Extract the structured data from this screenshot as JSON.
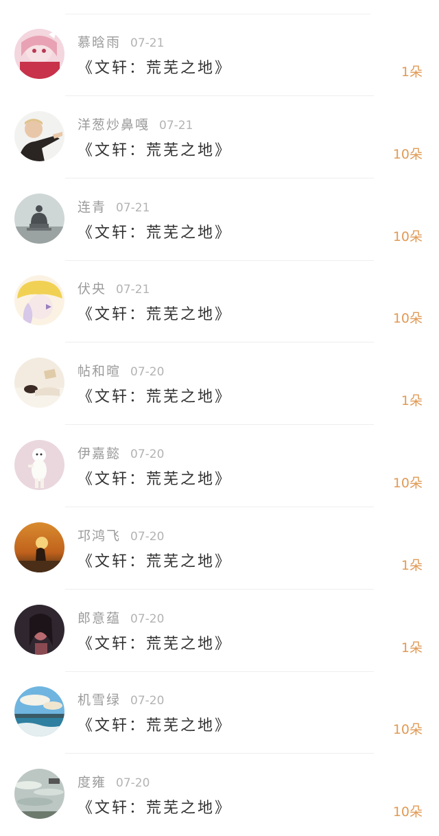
{
  "records": [
    {
      "name": "慕晗雨",
      "date": "07-21",
      "title": "《文轩：荒芜之地》",
      "amount": "1朵",
      "avatar_icon": "anime-girl-avatar"
    },
    {
      "name": "洋葱炒鼻嘎",
      "date": "07-21",
      "title": "《文轩：荒芜之地》",
      "amount": "10朵",
      "avatar_icon": "boy-avatar"
    },
    {
      "name": "连青",
      "date": "07-21",
      "title": "《文轩：荒芜之地》",
      "amount": "10朵",
      "avatar_icon": "buddha-statue-avatar"
    },
    {
      "name": "伏央",
      "date": "07-21",
      "title": "《文轩：荒芜之地》",
      "amount": "10朵",
      "avatar_icon": "yellow-hat-avatar"
    },
    {
      "name": "帖和暄",
      "date": "07-20",
      "title": "《文轩：荒芜之地》",
      "amount": "1朵",
      "avatar_icon": "sleeping-person-avatar"
    },
    {
      "name": "伊嘉懿",
      "date": "07-20",
      "title": "《文轩：荒芜之地》",
      "amount": "10朵",
      "avatar_icon": "white-dog-avatar"
    },
    {
      "name": "邛鸿飞",
      "date": "07-20",
      "title": "《文轩：荒芜之地》",
      "amount": "1朵",
      "avatar_icon": "sunset-avatar"
    },
    {
      "name": "郎意蕴",
      "date": "07-20",
      "title": "《文轩：荒芜之地》",
      "amount": "1朵",
      "avatar_icon": "dark-portrait-avatar"
    },
    {
      "name": "机雪绿",
      "date": "07-20",
      "title": "《文轩：荒芜之地》",
      "amount": "10朵",
      "avatar_icon": "seascape-avatar"
    },
    {
      "name": "度雍",
      "date": "07-20",
      "title": "《文轩：荒芜之地》",
      "amount": "10朵",
      "avatar_icon": "sky-avatar"
    }
  ]
}
